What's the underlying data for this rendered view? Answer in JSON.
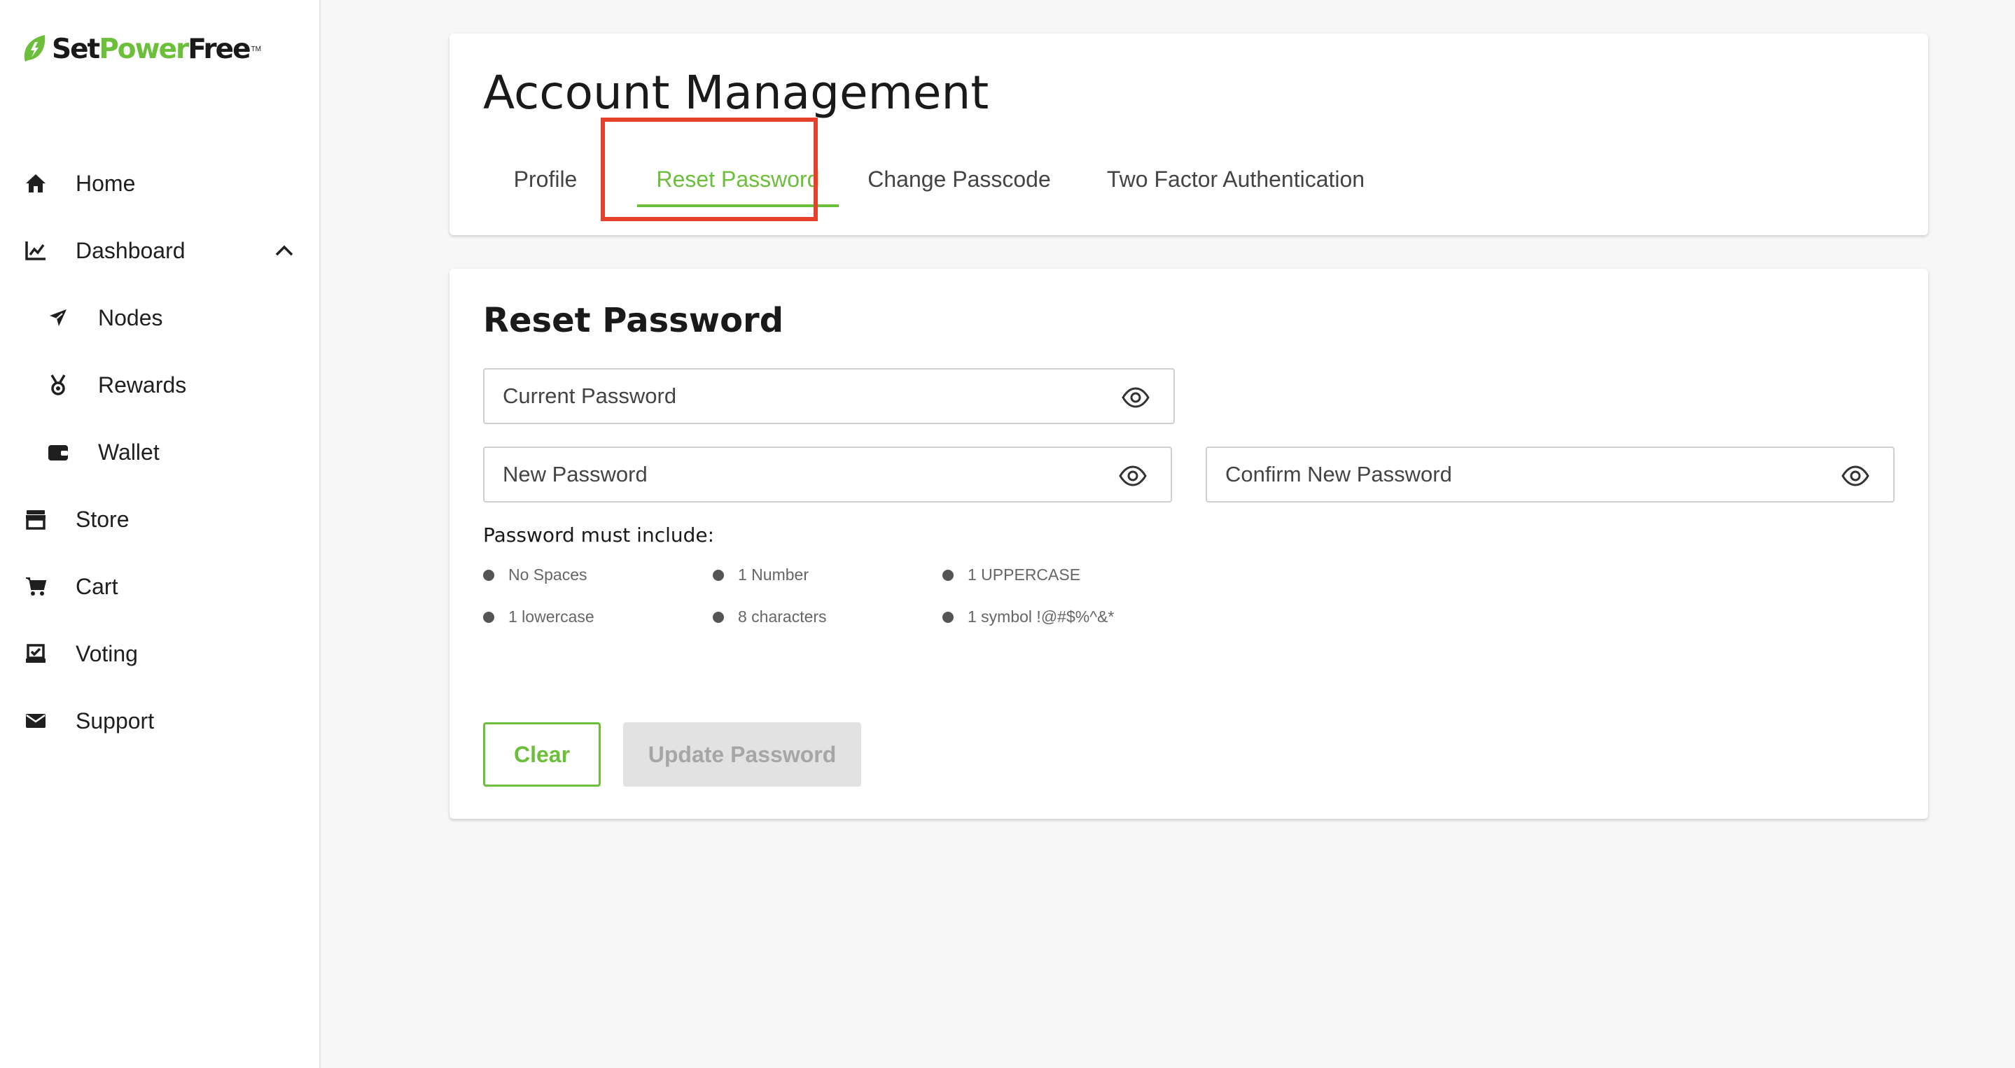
{
  "brand": {
    "part1": "Set",
    "part2": "Power",
    "part3": "Free",
    "tm": "TM",
    "accent_color": "#6cbf3a"
  },
  "sidebar": {
    "items": [
      {
        "label": "Home",
        "icon": "home-icon"
      },
      {
        "label": "Dashboard",
        "icon": "chart-line-icon",
        "expanded": true
      },
      {
        "label": "Nodes",
        "icon": "send-icon",
        "sub": true
      },
      {
        "label": "Rewards",
        "icon": "medal-icon",
        "sub": true
      },
      {
        "label": "Wallet",
        "icon": "wallet-icon",
        "sub": true
      },
      {
        "label": "Store",
        "icon": "store-icon"
      },
      {
        "label": "Cart",
        "icon": "cart-icon"
      },
      {
        "label": "Voting",
        "icon": "voting-icon"
      },
      {
        "label": "Support",
        "icon": "mail-icon"
      }
    ]
  },
  "header": {
    "title": "Account Management",
    "tabs": [
      {
        "label": "Profile",
        "active": false
      },
      {
        "label": "Reset Password",
        "active": true
      },
      {
        "label": "Change Passcode",
        "active": false
      },
      {
        "label": "Two Factor Authentication",
        "active": false
      }
    ],
    "highlight_color": "#e5412b"
  },
  "form": {
    "title": "Reset Password",
    "current_password": {
      "placeholder": "Current Password",
      "value": ""
    },
    "new_password": {
      "placeholder": "New Password",
      "value": ""
    },
    "confirm_password": {
      "placeholder": "Confirm New Password",
      "value": ""
    },
    "requirements_title": "Password must include:",
    "requirements": [
      "No Spaces",
      "1 Number",
      "1 UPPERCASE",
      "1 lowercase",
      "8 characters",
      "1 symbol !@#$%^&*"
    ],
    "clear_label": "Clear",
    "update_label": "Update Password"
  }
}
